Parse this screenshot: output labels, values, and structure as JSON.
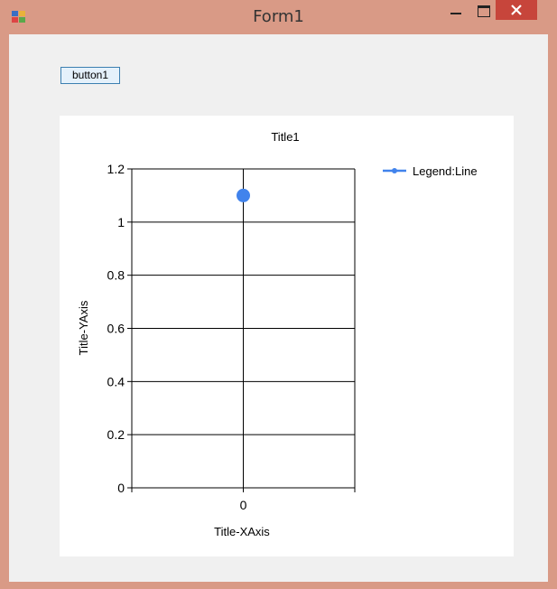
{
  "window": {
    "title": "Form1"
  },
  "form": {
    "button1_label": "button1"
  },
  "chart_data": {
    "type": "line",
    "title": "Title1",
    "xlabel": "Title-XAxis",
    "ylabel": "Title-YAxis",
    "categories": [
      "0"
    ],
    "series": [
      {
        "name": "Legend:Line",
        "values": [
          1.1
        ],
        "color": "#4183ec"
      }
    ],
    "ylim": [
      0,
      1.2
    ],
    "yticks": [
      0,
      0.2,
      0.4,
      0.6,
      0.8,
      1,
      1.2
    ],
    "ytick_labels": [
      "0",
      "0.2",
      "0.4",
      "0.6",
      "0.8",
      "1",
      "1.2"
    ],
    "grid": true,
    "legend": "top-right"
  }
}
